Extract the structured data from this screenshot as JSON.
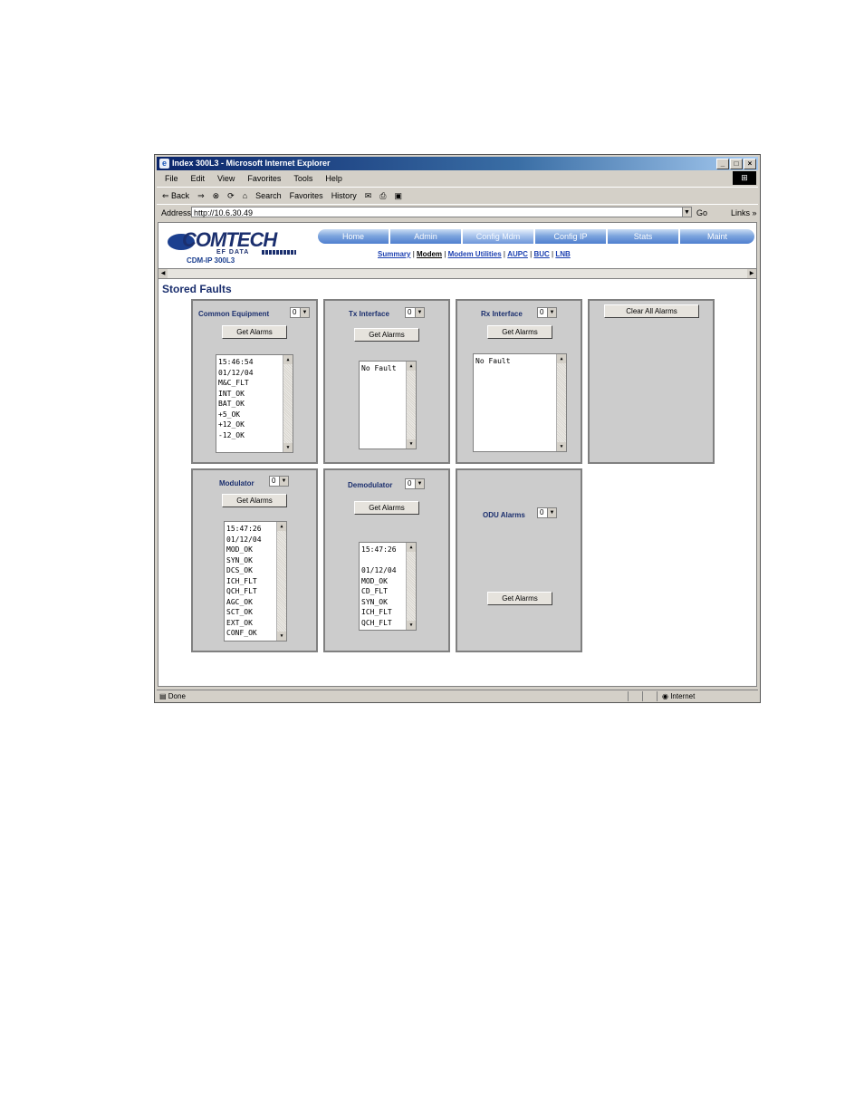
{
  "window": {
    "title": "Index 300L3 - Microsoft Internet Explorer",
    "min": "_",
    "max": "□",
    "close": "×"
  },
  "menu": [
    "File",
    "Edit",
    "View",
    "Favorites",
    "Tools",
    "Help"
  ],
  "toolbar": {
    "back": "⇐ Back",
    "fwd": "⇒",
    "stop": "⊗",
    "refresh": "⟳",
    "home": "⌂",
    "search": "Search",
    "favorites": "Favorites",
    "history": "History"
  },
  "address": {
    "label": "Address",
    "url": "http://10.6.30.49",
    "go": "Go",
    "links": "Links »"
  },
  "brand": {
    "logo": "COMTECH",
    "sub": "EF DATA",
    "model": "CDM-IP 300L3"
  },
  "nav": {
    "tabs": [
      "Home",
      "Admin",
      "Config Mdm",
      "Config IP",
      "Stats",
      "Maint"
    ]
  },
  "subnav": {
    "items": [
      "Summary",
      "Modem",
      "Modem Utilities",
      "AUPC",
      "BUC",
      "LNB"
    ],
    "sep": "|"
  },
  "page_title": "Stored Faults",
  "panels": {
    "common": {
      "title": "Common Equipment",
      "sel": "0",
      "btn": "Get Alarms",
      "lines": [
        "15:46:54",
        "01/12/04",
        "M&C_FLT",
        "INT_OK",
        "BAT_OK",
        "+5_OK",
        "+12_OK",
        "-12_OK"
      ]
    },
    "tx": {
      "title": "Tx Interface",
      "sel": "0",
      "btn": "Get Alarms",
      "lines": [
        "No Fault"
      ]
    },
    "rx": {
      "title": "Rx Interface",
      "sel": "0",
      "btn": "Get Alarms",
      "lines": [
        "No Fault"
      ]
    },
    "clear": {
      "btn": "Clear All Alarms"
    },
    "mod": {
      "title": "Modulator",
      "sel": "0",
      "btn": "Get Alarms",
      "lines": [
        "15:47:26",
        "01/12/04",
        "MOD_OK",
        "SYN_OK",
        "DCS_OK",
        "ICH_FLT",
        "QCH_FLT",
        "AGC_OK",
        "SCT_OK",
        "EXT_OK",
        "CONF_OK"
      ]
    },
    "demod": {
      "title": "Demodulator",
      "sel": "0",
      "btn": "Get Alarms",
      "lines": [
        "15:47:26",
        "",
        "01/12/04",
        "MOD_OK",
        "CD_FLT",
        "SYN_OK",
        "ICH_FLT",
        "QCH_FLT"
      ]
    },
    "odu": {
      "title": "ODU Alarms",
      "sel": "0",
      "btn": "Get Alarms"
    }
  },
  "status": {
    "done": "Done",
    "zone": "Internet"
  }
}
